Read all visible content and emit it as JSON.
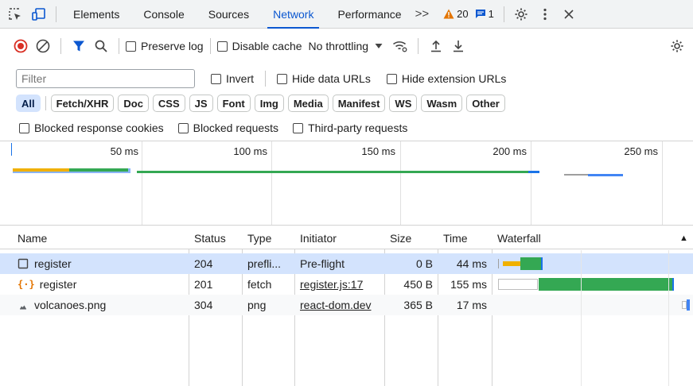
{
  "tabs": {
    "items": [
      "Elements",
      "Console",
      "Sources",
      "Network",
      "Performance"
    ],
    "more": ">>",
    "warning_count": "20",
    "message_count": "1"
  },
  "toolbar": {
    "preserve_log": "Preserve log",
    "disable_cache": "Disable cache",
    "throttling": "No throttling"
  },
  "filter": {
    "placeholder": "Filter",
    "invert": "Invert",
    "hide_data_urls": "Hide data URLs",
    "hide_extension_urls": "Hide extension URLs"
  },
  "chips": [
    "All",
    "Fetch/XHR",
    "Doc",
    "CSS",
    "JS",
    "Font",
    "Img",
    "Media",
    "Manifest",
    "WS",
    "Wasm",
    "Other"
  ],
  "blocked": {
    "cookies": "Blocked response cookies",
    "requests": "Blocked requests",
    "third_party": "Third-party requests"
  },
  "overview": {
    "ticks": [
      "50 ms",
      "100 ms",
      "150 ms",
      "200 ms",
      "250 ms"
    ]
  },
  "table": {
    "columns": [
      "Name",
      "Status",
      "Type",
      "Initiator",
      "Size",
      "Time",
      "Waterfall"
    ],
    "sort_icon": "▲",
    "rows": [
      {
        "name": "register",
        "status": "204",
        "type": "prefli...",
        "initiator": "Pre-flight",
        "size": "0 B",
        "time": "44 ms"
      },
      {
        "name": "register",
        "status": "201",
        "type": "fetch",
        "initiator": "register.js:17",
        "size": "450 B",
        "time": "155 ms"
      },
      {
        "name": "volcanoes.png",
        "status": "304",
        "type": "png",
        "initiator": "react-dom.dev",
        "size": "365 B",
        "time": "17 ms"
      }
    ]
  },
  "colors": {
    "accent": "#0b57d0",
    "waiting": "#f0b000",
    "download": "#34a853",
    "selected_row": "#d3e3fd",
    "record_red": "#d93025",
    "warning": "#e37400"
  }
}
